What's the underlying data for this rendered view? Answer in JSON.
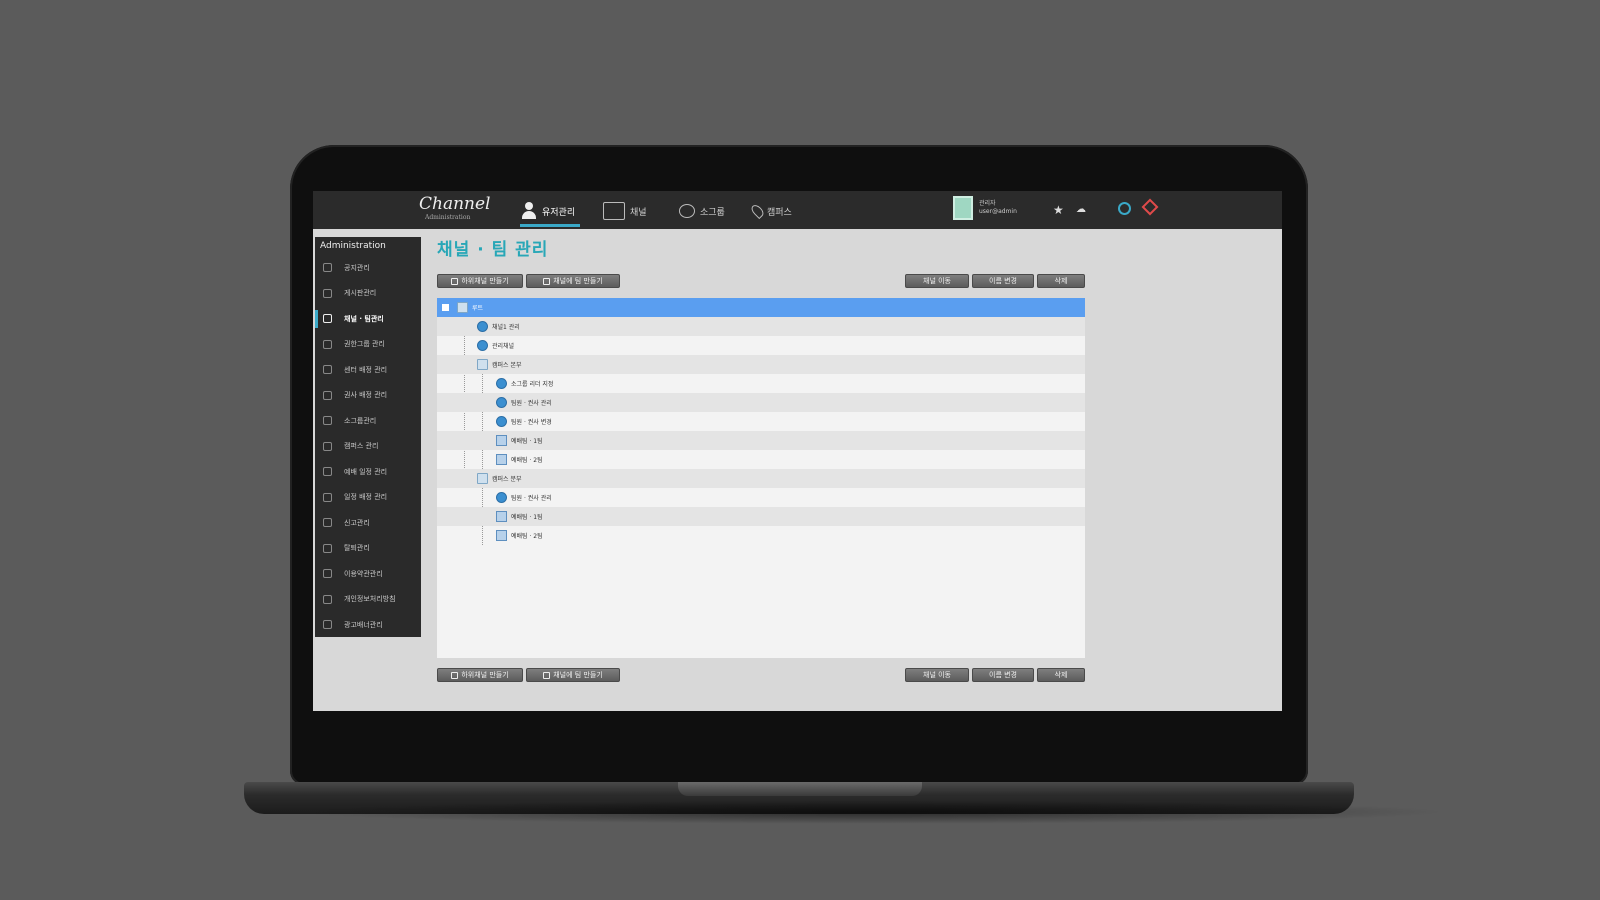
{
  "app": {
    "logo": "Channel",
    "logo_sub": "Administration"
  },
  "topnav": {
    "items": [
      {
        "label": "유저관리",
        "icon": "user-icon",
        "active": true
      },
      {
        "label": "채널",
        "icon": "home-icon"
      },
      {
        "label": "소그룹",
        "icon": "chat-icon"
      },
      {
        "label": "캠퍼스",
        "icon": "location-pin-icon"
      }
    ],
    "user_name": "관리자",
    "user_email": "user@admin"
  },
  "sidebar": {
    "title": "Administration",
    "items": [
      {
        "label": "공지관리"
      },
      {
        "label": "게시판관리"
      },
      {
        "label": "채널 · 팀관리",
        "active": true
      },
      {
        "label": "권한그룹 관리"
      },
      {
        "label": "센터 배정 관리"
      },
      {
        "label": "권사 배정 관리"
      },
      {
        "label": "소그룹관리"
      },
      {
        "label": "캠퍼스 관리"
      },
      {
        "label": "예배 일정 관리"
      },
      {
        "label": "일정 배정 관리"
      },
      {
        "label": "신고관리"
      },
      {
        "label": "탈퇴관리"
      },
      {
        "label": "이용약관관리"
      },
      {
        "label": "개인정보처리방침"
      },
      {
        "label": "광고배너관리"
      }
    ]
  },
  "page": {
    "title": "채널 · 팀 관리"
  },
  "toolbar": {
    "left_buttons": [
      "하위채널 만들기",
      "채널에 팀 만들기"
    ],
    "right_buttons": [
      "채널 이동",
      "이름 변경",
      "삭제"
    ]
  },
  "tree": {
    "rows": [
      {
        "label": "루트",
        "level": 0,
        "type": "folder",
        "selected": true
      },
      {
        "label": "채널1 관리",
        "level": 1,
        "type": "channel"
      },
      {
        "label": "관리채널",
        "level": 1,
        "type": "channel"
      },
      {
        "label": "캠퍼스 본부",
        "level": 1,
        "type": "folder"
      },
      {
        "label": "소그룹 리더 지정",
        "level": 2,
        "type": "channel"
      },
      {
        "label": "팀원 · 권사 관리",
        "level": 2,
        "type": "channel"
      },
      {
        "label": "팀원 · 권사 변경",
        "level": 2,
        "type": "channel"
      },
      {
        "label": "예배팀 · 1팀",
        "level": 2,
        "type": "team"
      },
      {
        "label": "예배팀 · 2팀",
        "level": 2,
        "type": "team"
      },
      {
        "label": "캠퍼스 분부",
        "level": 1,
        "type": "folder"
      },
      {
        "label": "팀원 · 권사 관리",
        "level": 2,
        "type": "channel"
      },
      {
        "label": "예배팀 · 1팀",
        "level": 2,
        "type": "team"
      },
      {
        "label": "예배팀 · 2팀",
        "level": 2,
        "type": "team"
      }
    ]
  }
}
